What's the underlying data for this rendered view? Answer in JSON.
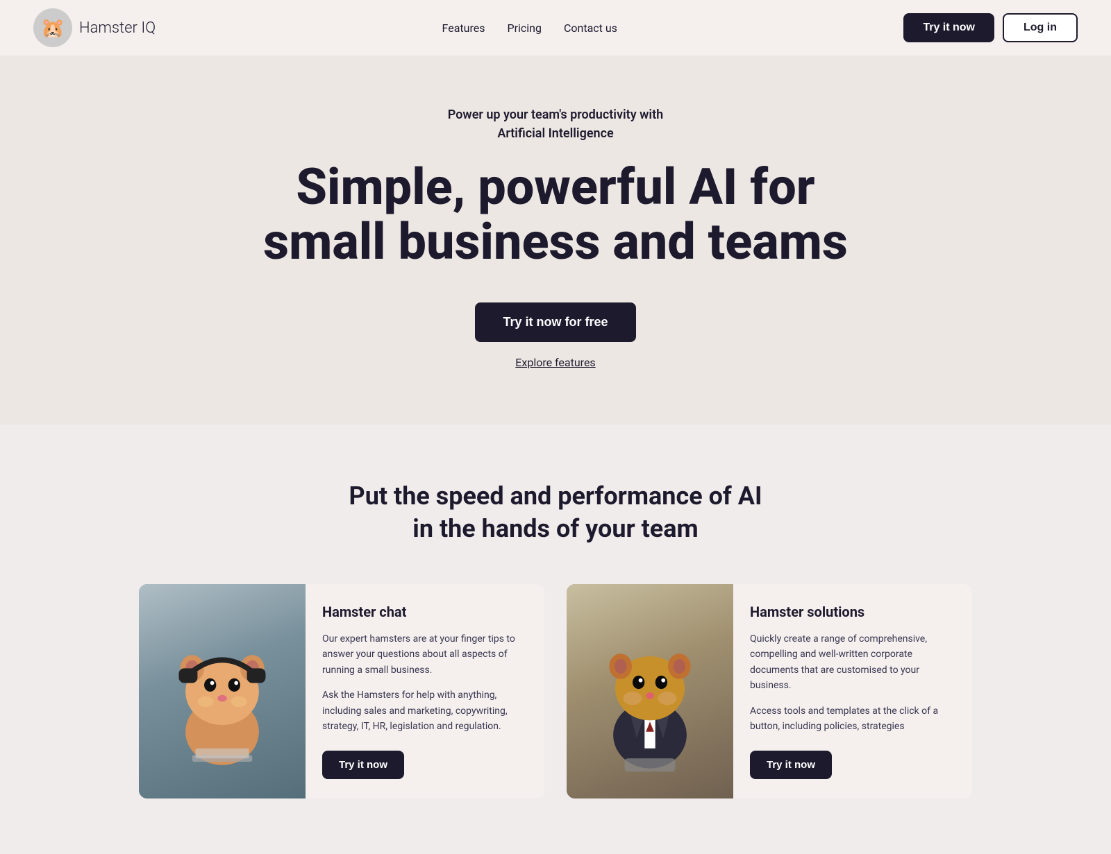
{
  "header": {
    "logo_brand": "Hamster",
    "logo_suffix": "IQ",
    "nav": {
      "items": [
        {
          "id": "features",
          "label": "Features"
        },
        {
          "id": "pricing",
          "label": "Pricing"
        },
        {
          "id": "contact",
          "label": "Contact us"
        }
      ]
    },
    "try_now_label": "Try it now",
    "login_label": "Log in"
  },
  "hero": {
    "subtitle": "Power up your team's productivity with\nArtificial Intelligence",
    "title_line1": "Simple, powerful AI for",
    "title_line2": "small business and teams",
    "cta_button": "Try it now for free",
    "explore_link": "Explore features"
  },
  "features": {
    "section_title_line1": "Put the speed and performance of AI",
    "section_title_line2": "in the hands of your team",
    "cards": [
      {
        "id": "hamster-chat",
        "title": "Hamster chat",
        "text1": "Our expert hamsters are at your finger tips to answer your questions about all aspects of running a small business.",
        "text2": "Ask the Hamsters for help with anything, including sales and marketing, copywriting, strategy, IT, HR, legislation and regulation.",
        "button_label": "Try it now"
      },
      {
        "id": "hamster-solutions",
        "title": "Hamster solutions",
        "text1": "Quickly create a range of comprehensive, compelling and well-written corporate documents that are customised to your business.",
        "text2": "Access tools and templates at the click of a button, including policies, strategies",
        "button_label": "Try it now"
      }
    ]
  }
}
